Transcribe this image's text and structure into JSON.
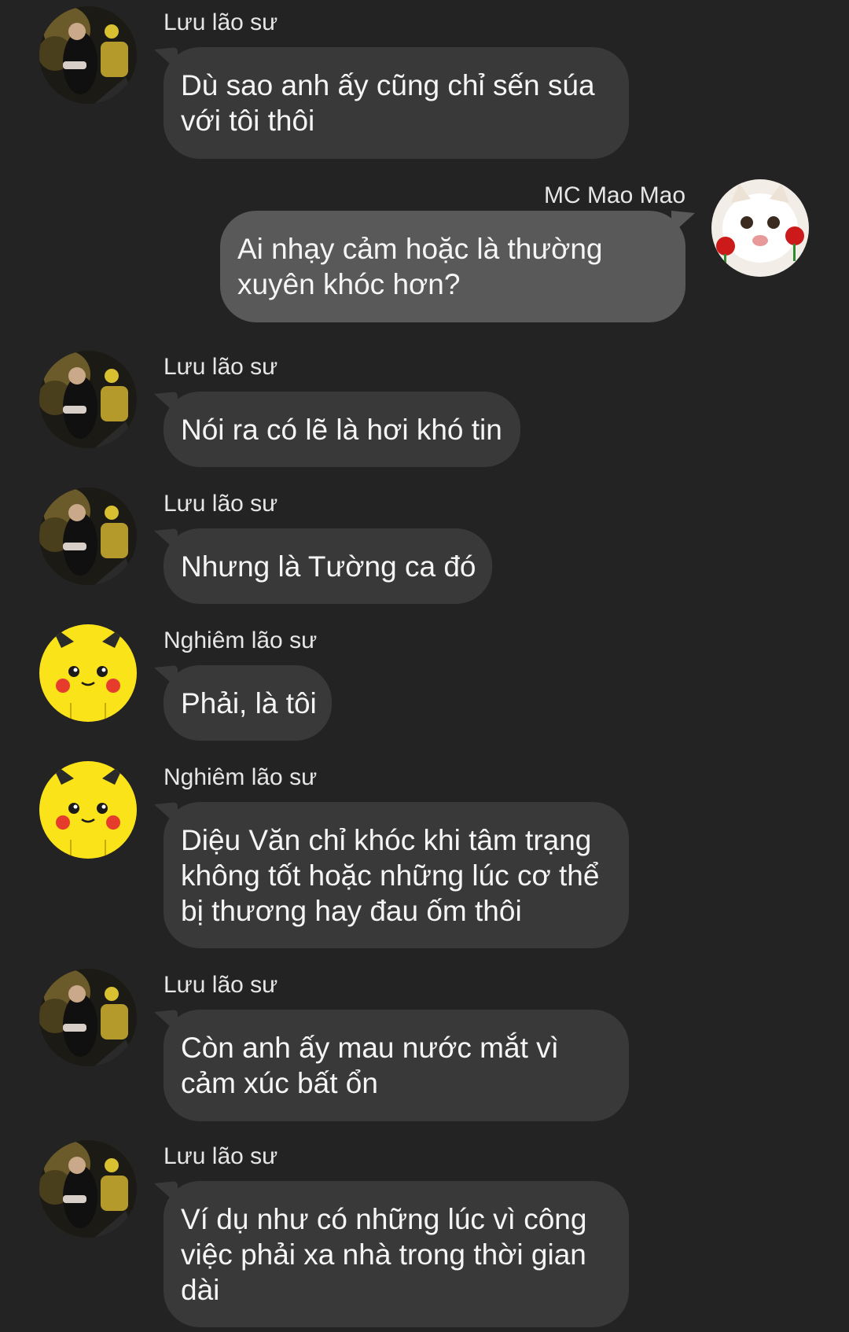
{
  "colors": {
    "background": "#232323",
    "incoming_bubble": "#393939",
    "outgoing_bubble": "#595959",
    "text": "#f5f5f5"
  },
  "messages": [
    {
      "sender": "Lưu lão sư",
      "lines": [
        "Dù sao anh ấy cũng chỉ sến súa",
        "với tôi thôi"
      ],
      "avatar": "dark-photo-avatar"
    },
    {
      "sender": "MC Mao Mao",
      "lines": [
        "Ai nhạy cảm hoặc là thường",
        "xuyên khóc hơn?"
      ],
      "avatar": "cat-rose-avatar"
    },
    {
      "sender": "Lưu lão sư",
      "lines": [
        "Nói ra có lẽ là hơi khó tin"
      ],
      "avatar": "dark-photo-avatar"
    },
    {
      "sender": "Lưu lão sư",
      "lines": [
        "Nhưng là Tường ca đó"
      ],
      "avatar": "dark-photo-avatar"
    },
    {
      "sender": "Nghiêm lão sư",
      "lines": [
        "Phải, là tôi"
      ],
      "avatar": "pikachu-avatar"
    },
    {
      "sender": "Nghiêm lão sư",
      "lines": [
        "Diệu Văn chỉ khóc khi tâm trạng",
        "không tốt hoặc những lúc cơ thể",
        "bị thương hay đau ốm thôi"
      ],
      "avatar": "pikachu-avatar"
    },
    {
      "sender": "Lưu lão sư",
      "lines": [
        "Còn anh ấy mau nước mắt vì",
        "cảm xúc bất ổn"
      ],
      "avatar": "dark-photo-avatar"
    },
    {
      "sender": "Lưu lão sư",
      "lines": [
        "Ví dụ như có những lúc vì công",
        "việc phải xa nhà trong thời gian",
        "dài"
      ],
      "avatar": "dark-photo-avatar"
    }
  ]
}
